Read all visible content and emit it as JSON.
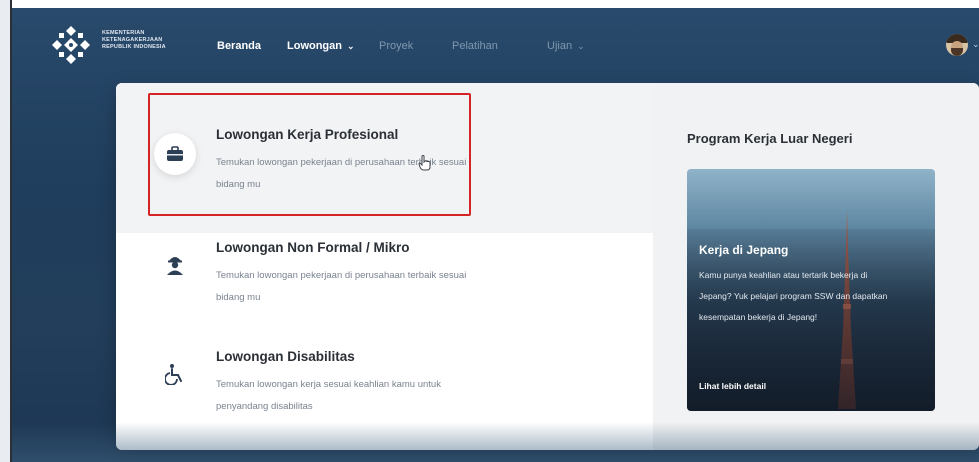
{
  "header": {
    "org_line1": "KEMENTERIAN",
    "org_line2": "KETENAGAKERJAAN",
    "org_line3": "REPUBLIK INDONESIA",
    "nav": {
      "home": "Beranda",
      "jobs": "Lowongan",
      "project": "Proyek",
      "training": "Pelatihan",
      "exam": "Ujian"
    },
    "avatar_icon": "user-avatar"
  },
  "dropdown": {
    "items": [
      {
        "title": "Lowongan Kerja Profesional",
        "desc": "Temukan lowongan pekerjaan di perusahaan terbaik sesuai bidang mu",
        "icon": "briefcase-icon"
      },
      {
        "title": "Lowongan Non Formal / Mikro",
        "desc": "Temukan lowongan pekerjaan di perusahaan terbaik sesuai bidang mu",
        "icon": "worker-icon"
      },
      {
        "title": "Lowongan Disabilitas",
        "desc": "Temukan lowongan kerja sesuai keahlian kamu untuk penyandang disabilitas",
        "icon": "wheelchair-icon"
      }
    ],
    "program": {
      "heading": "Program Kerja Luar Negeri",
      "card_title": "Kerja di Jepang",
      "card_desc": "Kamu punya keahlian atau tertarik bekerja di Jepang? Yuk pelajari program SSW dan dapatkan kesempatan bekerja di Jepang!",
      "card_link": "Lihat lebih detail"
    }
  },
  "colors": {
    "navy_bg": "#1f3d5c",
    "highlight_border": "#d42426",
    "text_dark": "#2b2f36",
    "text_muted": "#7a8390"
  }
}
